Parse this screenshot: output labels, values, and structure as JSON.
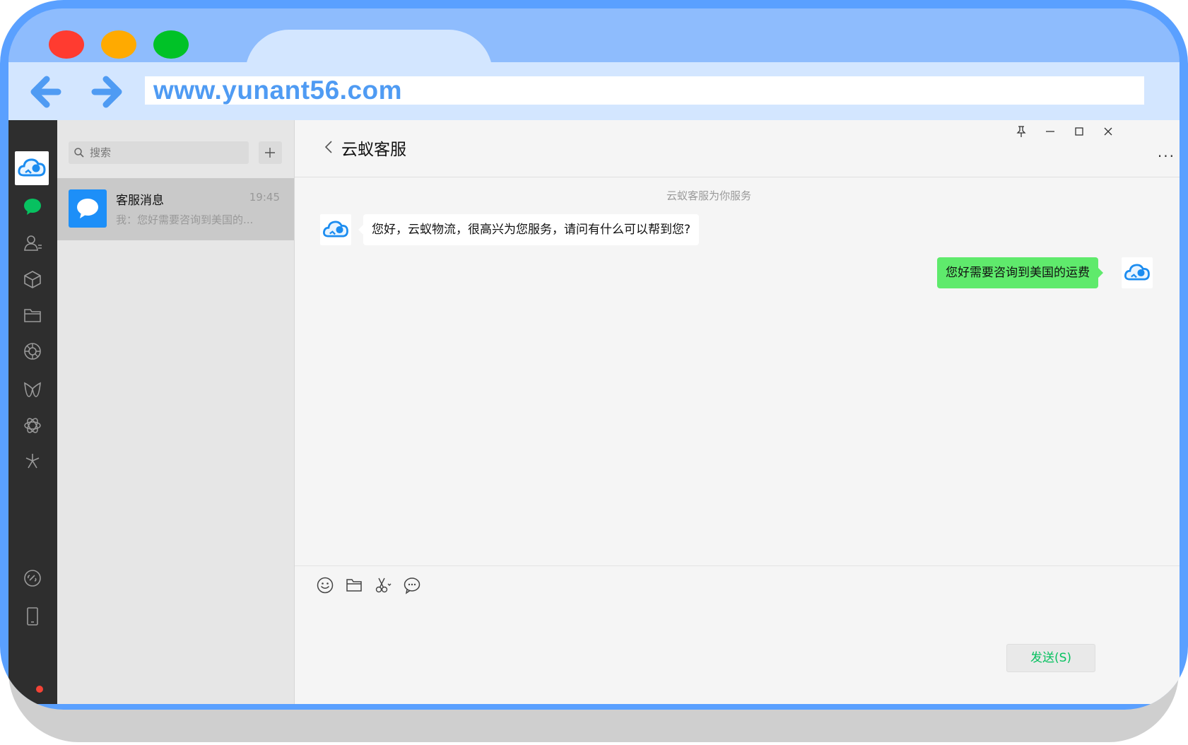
{
  "browser": {
    "url": "www.yunant56.com",
    "colors": {
      "frame": "#5aa0ff",
      "tabbar": "#8ebcfd",
      "tab": "#d3e6ff",
      "url_text": "#4f9bf3"
    },
    "traffic_lights": [
      "red",
      "yellow",
      "green"
    ]
  },
  "rail": {
    "icons": [
      "logo-icon",
      "chat-icon",
      "contacts-icon",
      "box-icon",
      "folder-icon",
      "moments-icon",
      "channels-icon",
      "mini-program-icon",
      "discover-icon",
      "link-icon",
      "phone-icon"
    ]
  },
  "sidebar": {
    "search_placeholder": "搜索",
    "sessions": [
      {
        "name": "客服消息",
        "time": "19:45",
        "preview": "我：您好需要咨询到美国的..."
      }
    ]
  },
  "chat": {
    "title": "云蚁客服",
    "system_message": "云蚁客服为你服务",
    "messages": [
      {
        "direction": "incoming",
        "text": "您好，云蚁物流，很高兴为您服务，请问有什么可以帮到您?"
      },
      {
        "direction": "outgoing",
        "text": "您好需要咨询到美国的运费"
      }
    ],
    "more": "...",
    "send_label": "发送(S)",
    "accent": "#07c160",
    "outgoing_bubble": "#5fea6c"
  }
}
